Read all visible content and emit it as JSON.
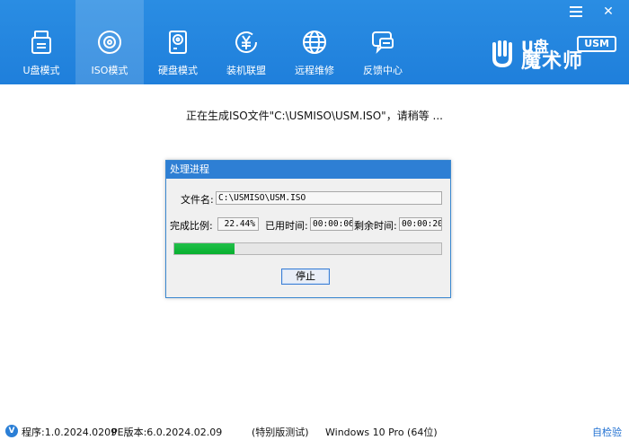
{
  "window": {
    "menu_icon": "hamburger-icon",
    "close_icon": "close-icon",
    "close_glyph": "✕"
  },
  "nav": [
    {
      "label": "U盘模式",
      "icon": "usb-drive-icon",
      "active": false
    },
    {
      "label": "ISO模式",
      "icon": "disc-icon",
      "active": true
    },
    {
      "label": "硬盘模式",
      "icon": "hard-disk-icon",
      "active": false
    },
    {
      "label": "装机联盟",
      "icon": "yen-coin-icon",
      "active": false
    },
    {
      "label": "远程维修",
      "icon": "globe-icon",
      "active": false
    },
    {
      "label": "反馈中心",
      "icon": "chat-bubble-icon",
      "active": false
    }
  ],
  "logo": {
    "top": "U盘",
    "badge": "USM",
    "main": "魔术师"
  },
  "status_message": "正在生成ISO文件\"C:\\USMISO\\USM.ISO\"，请稍等 ...",
  "dialog": {
    "title": "处理进程",
    "filename_label": "文件名:",
    "filename_value": "C:\\USMISO\\USM.ISO",
    "ratio_label": "完成比例:",
    "ratio_value": "22.44%",
    "elapsed_label": "已用时间:",
    "elapsed_value": "00:00:06",
    "remaining_label": "剩余时间:",
    "remaining_value": "00:00:20",
    "progress": 0.2244,
    "stop_label": "停止"
  },
  "footer": {
    "badge": "V",
    "program_version": "程序:1.0.2024.0209",
    "pe_version": "PE版本:6.0.2024.02.09",
    "edition": "(特别版测试)",
    "os": "Windows 10 Pro (64位)",
    "self_check": "自检验"
  },
  "colors": {
    "header": "#2185de",
    "accent": "#2e7fd4",
    "progress": "#0fb739"
  }
}
